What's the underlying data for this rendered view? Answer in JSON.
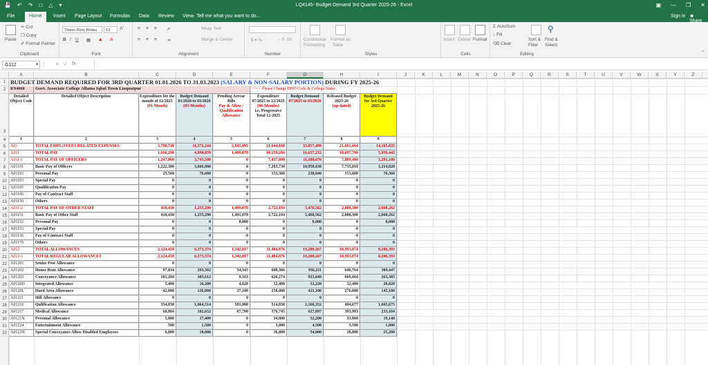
{
  "window": {
    "title": "LQ4145- Budget Demand 3rd Quarter 2025-26 - Excel",
    "signin": "Sign in",
    "share": "Share"
  },
  "tabs": [
    "File",
    "Home",
    "Insert",
    "Page Layout",
    "Formulas",
    "Data",
    "Review",
    "View"
  ],
  "tell_me": "Tell me what you want to do...",
  "ribbon": {
    "cut": "Cut",
    "copy": "Copy",
    "format_painter": "Format Painter",
    "paste": "Paste",
    "clipboard": "Clipboard",
    "font_name": "Times New Roma",
    "font_size": "12",
    "font": "Font",
    "wrap_text": "Wrap Text",
    "merge_center": "Merge & Center",
    "alignment": "Alignment",
    "number": "Number",
    "conditional": "Conditional",
    "formatting": "Formatting",
    "format_as": "Format as",
    "table": "Table",
    "styles": "Styles",
    "insert": "Insert",
    "delete": "Delete",
    "format": "Format",
    "cells": "Cells",
    "autosum": "AutoSum",
    "fill": "Fill",
    "clear": "Clear",
    "sort_filter": "Sort &",
    "filter": "Filter",
    "find_select": "Find &",
    "select": "Select",
    "editing": "Editing"
  },
  "name_box": "G112",
  "fx": "fx",
  "col_letters": [
    "A",
    "B",
    "C",
    "D",
    "E",
    "F",
    "G",
    "H",
    "I",
    "J",
    "K",
    "L",
    "M",
    "N",
    "O",
    "P",
    "Q",
    "R",
    "S",
    "T",
    "U",
    "V",
    "W",
    "X",
    "Y",
    "Z"
  ],
  "row_numbers": [
    "1",
    "2",
    "3",
    "4",
    "5",
    "6",
    "7",
    "8",
    "9",
    "10",
    "11",
    "12",
    "13",
    "14",
    "15",
    "16",
    "17",
    "18",
    "19",
    "20",
    "21",
    "22",
    "23",
    "24",
    "25",
    "26",
    "27",
    "28",
    "29",
    "30",
    "31",
    "32"
  ],
  "sheet": {
    "title_main": "BUDGET DEMAND REQUIRED FOR 3RD QUARTER 01.01.2026 TO 31.03.2023",
    "title_blue": "(SALARY & NON-SALARY PORTION)",
    "title_end": "DURING FY 2025-26",
    "ddo_code": "RN4068",
    "college": "Govt. Associate College Allama Iqbal Town Liaquatpur",
    "note": "<<<< Please Change DDO Code & College Name",
    "headers": {
      "a": "Detailed Object Code",
      "b": "Detailed Object Description",
      "c1": "Expenditure for the month of 12/2025",
      "c2": "(01-Month)",
      "d1": "Budget Demand 01/2026 to 03/2026",
      "d2": "(03-Months)",
      "e1": "Pending Arrear Bills",
      "e2": "Pay & Allow / Qualification Allowance",
      "f1": "Expenditure 07/2025 to 12/2025",
      "f2": "(06-Months)",
      "f3": "i.e. Progressive Total 12-2025",
      "g1": "Budget Demand",
      "g2": "07/2025 to 03/2026",
      "h1": "Released Budget 2025-26",
      "h2": "(up-dated)",
      "i1": "Budget Demand for 3rd Quarter 2025-26"
    },
    "numbers": [
      "1",
      "2",
      "3",
      "4",
      "5",
      "6",
      "7",
      "8",
      "9"
    ],
    "rows": [
      {
        "code": "A01",
        "desc": "TOTAL EMPLOYEES RELATED EXPENSES",
        "red": true,
        "v": [
          "3,790,748",
          "11,372,244",
          "2,841,095",
          "21,644,160",
          "35,857,499",
          "21,691,664",
          "14,165,835"
        ]
      },
      {
        "code": "A011",
        "desc": "TOTAL PAY",
        "red": true,
        "v": [
          "1,666,290",
          "4,998,870",
          "1,499,078",
          "10,159,284",
          "16,657,232",
          "10,697,790",
          "5,959,442"
        ]
      },
      {
        "code": "A011-1",
        "desc": "TOTAL PAY OF OFFICERS",
        "red": true,
        "v": [
          "1,247,860",
          "3,743,580",
          "0",
          "7,437,090",
          "11,180,670",
          "7,889,490",
          "3,291,180"
        ]
      },
      {
        "code": "A01101",
        "desc": "Basic Pay of Officers",
        "red": false,
        "v": [
          "1,222,300",
          "3,666,900",
          "0",
          "7,283,730",
          "10,950,630",
          "7,735,810",
          "3,214,820"
        ]
      },
      {
        "code": "A01102",
        "desc": "Personal Pay",
        "red": false,
        "v": [
          "25,560",
          "76,680",
          "0",
          "153,360",
          "230,040",
          "153,680",
          "76,360"
        ]
      },
      {
        "code": "A01103",
        "desc": "Special Pay",
        "red": false,
        "v": [
          "0",
          "0",
          "0",
          "0",
          "0",
          "0",
          "0"
        ]
      },
      {
        "code": "A01105",
        "desc": "Qualification Pay",
        "red": false,
        "v": [
          "0",
          "0",
          "0",
          "0",
          "0",
          "0",
          "0"
        ]
      },
      {
        "code": "A01106",
        "desc": "Pay of Contract Staff",
        "red": false,
        "v": [
          "0",
          "0",
          "0",
          "0",
          "0",
          "0",
          "0"
        ]
      },
      {
        "code": "A01150",
        "desc": "Others",
        "red": false,
        "v": [
          "0",
          "0",
          "0",
          "0",
          "0",
          "0",
          "0"
        ]
      },
      {
        "code": "A011-2",
        "desc": "TOTAL PAY OF OTHER STAFF",
        "red": true,
        "v": [
          "418,430",
          "1,255,290",
          "1,499,078",
          "2,722,194",
          "5,476,562",
          "2,808,300",
          "2,668,262"
        ]
      },
      {
        "code": "A01151",
        "desc": "Basic Pay of Other Staff",
        "red": false,
        "v": [
          "418,430",
          "1,255,290",
          "1,491,078",
          "2,722,194",
          "5,468,562",
          "2,808,300",
          "2,660,262"
        ]
      },
      {
        "code": "A01152",
        "desc": "Personal Pay",
        "red": false,
        "v": [
          "0",
          "0",
          "8,000",
          "0",
          "8,000",
          "0",
          "8,000"
        ]
      },
      {
        "code": "A01153",
        "desc": "Special Pay",
        "red": false,
        "v": [
          "0",
          "0",
          "0",
          "0",
          "0",
          "0",
          "0"
        ]
      },
      {
        "code": "A01156",
        "desc": "Pay of Contract Staff",
        "red": false,
        "v": [
          "0",
          "0",
          "0",
          "0",
          "0",
          "0",
          "0"
        ]
      },
      {
        "code": "A01170",
        "desc": "Others",
        "red": false,
        "v": [
          "0",
          "0",
          "0",
          "0",
          "0",
          "0",
          "0"
        ]
      },
      {
        "code": "A012",
        "desc": "TOTAL ALLOWANCES",
        "red": true,
        "v": [
          "2,124,458",
          "6,373,374",
          "1,342,017",
          "11,484,876",
          "19,200,267",
          "10,993,874",
          "8,206,393"
        ]
      },
      {
        "code": "A012-1",
        "desc": "TOTAL REGULAR ALLOWANCES",
        "red": true,
        "v": [
          "2,124,458",
          "6,373,374",
          "1,342,017",
          "11,484,876",
          "19,200,267",
          "10,993,874",
          "8,206,393"
        ]
      },
      {
        "code": "A01201",
        "desc": "Senior Post Allowance",
        "red": false,
        "v": [
          "0",
          "0",
          "0",
          "0",
          "0",
          "0",
          "0"
        ]
      },
      {
        "code": "A01202",
        "desc": "House Rent Allowance",
        "red": false,
        "v": [
          "97,834",
          "293,502",
          "54,343",
          "608,366",
          "956,211",
          "646,764",
          "309,447"
        ]
      },
      {
        "code": "A01203",
        "desc": "Conveyance Allowance",
        "red": false,
        "v": [
          "101,204",
          "303,612",
          "9,163",
          "620,274",
          "933,049",
          "669,664",
          "263,385"
        ]
      },
      {
        "code": "A0120D",
        "desc": "Integrated Allowance",
        "red": false,
        "v": [
          "5,400",
          "16,200",
          "4,620",
          "32,400",
          "53,220",
          "32,400",
          "20,820"
        ]
      },
      {
        "code": "A0120L",
        "desc": "Hard Area Allowance",
        "red": false,
        "v": [
          "42,000",
          "126,000",
          "37,100",
          "258,000",
          "421,100",
          "276,000",
          "145,100"
        ]
      },
      {
        "code": "A01211",
        "desc": "Hill Allowance",
        "red": false,
        "v": [
          "0",
          "0",
          "0",
          "0",
          "0",
          "0",
          "0"
        ]
      },
      {
        "code": "A01216",
        "desc": "Qulification Allowance",
        "red": false,
        "v": [
          "354,838",
          "1,064,514",
          "581,000",
          "514,838",
          "2,160,352",
          "494,677",
          "1,665,675"
        ]
      },
      {
        "code": "A01217",
        "desc": "Medical Allowance",
        "red": false,
        "v": [
          "60,884",
          "182,652",
          "67,700",
          "376,745",
          "627,097",
          "393,993",
          "233,104"
        ]
      },
      {
        "code": "A0121N",
        "desc": "Personal Allowance",
        "red": false,
        "v": [
          "5,800",
          "17,400",
          "0",
          "34,800",
          "52,200",
          "33,060",
          "19,140"
        ]
      },
      {
        "code": "A01224",
        "desc": "Entertainment Allowance",
        "red": false,
        "v": [
          "500",
          "1,500",
          "0",
          "3,000",
          "4,500",
          "3,500",
          "1,000"
        ]
      },
      {
        "code": "A0122N",
        "desc": "Special Conveyance Allow Disabled Employees",
        "red": false,
        "v": [
          "6,000",
          "18,000",
          "0",
          "36,000",
          "54,000",
          "28,800",
          "25,200"
        ]
      }
    ]
  }
}
